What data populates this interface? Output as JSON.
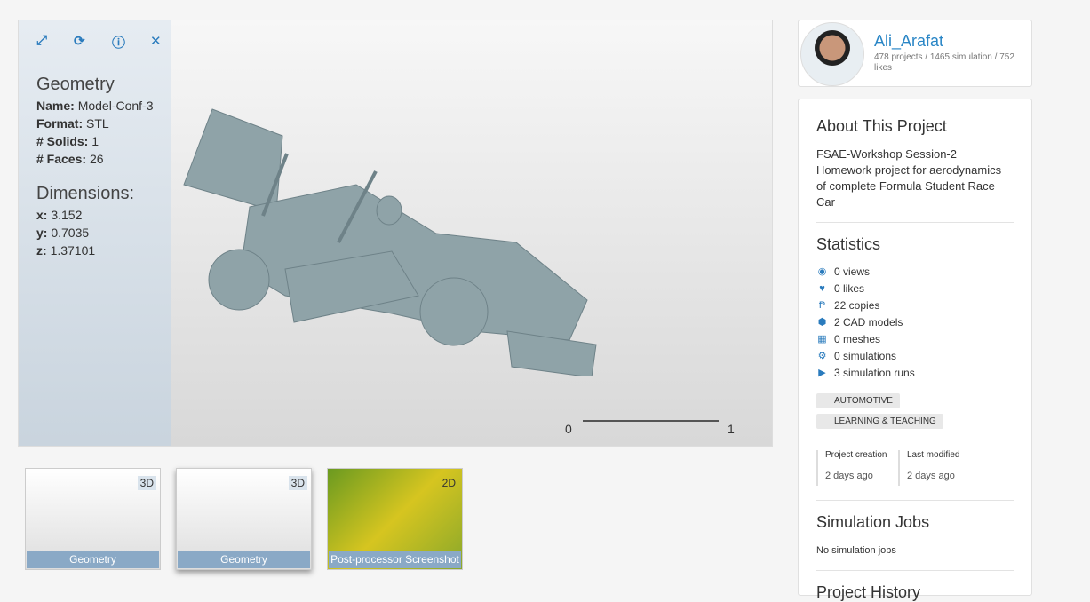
{
  "viewer": {
    "title": "Geometry",
    "name_label": "Name:",
    "name": "Model-Conf-3",
    "format_label": "Format:",
    "format": "STL",
    "solids_label": "# Solids:",
    "solids": "1",
    "faces_label": "# Faces:",
    "faces": "26",
    "dim_title": "Dimensions:",
    "x_label": "x:",
    "x": "3.152",
    "y_label": "y:",
    "y": "0.7035",
    "z_label": "z:",
    "z": "1.37101",
    "scale_min": "0",
    "scale_max": "1",
    "icons": [
      "fullscreen-icon",
      "refresh-icon",
      "info-icon",
      "close-icon"
    ]
  },
  "thumbnails": [
    {
      "caption": "Geometry",
      "badge": "3D"
    },
    {
      "caption": "Geometry",
      "badge": "3D"
    },
    {
      "caption": "Post-processor Screenshot",
      "badge": "2D"
    }
  ],
  "user": {
    "name": "Ali_Arafat",
    "stats": "478 projects / 1465 simulation / 752 likes"
  },
  "about": {
    "title": "About This Project",
    "description": "FSAE-Workshop Session-2 Homework project for aerodynamics of complete Formula Student Race Car"
  },
  "statistics": {
    "title": "Statistics",
    "items": [
      "0 views",
      "0 likes",
      "22 copies",
      "2 CAD models",
      "0 meshes",
      "0 simulations",
      "3 simulation runs"
    ]
  },
  "tags": [
    "AUTOMOTIVE",
    "LEARNING & TEACHING"
  ],
  "dates": {
    "created_label": "Project creation",
    "created": "2 days ago",
    "modified_label": "Last modified",
    "modified": "2 days ago"
  },
  "jobs": {
    "title": "Simulation Jobs",
    "empty": "No simulation jobs"
  },
  "history": {
    "title": "Project History"
  },
  "colors": {
    "accent": "#2a7bbd",
    "model": "#8fa3a8"
  }
}
